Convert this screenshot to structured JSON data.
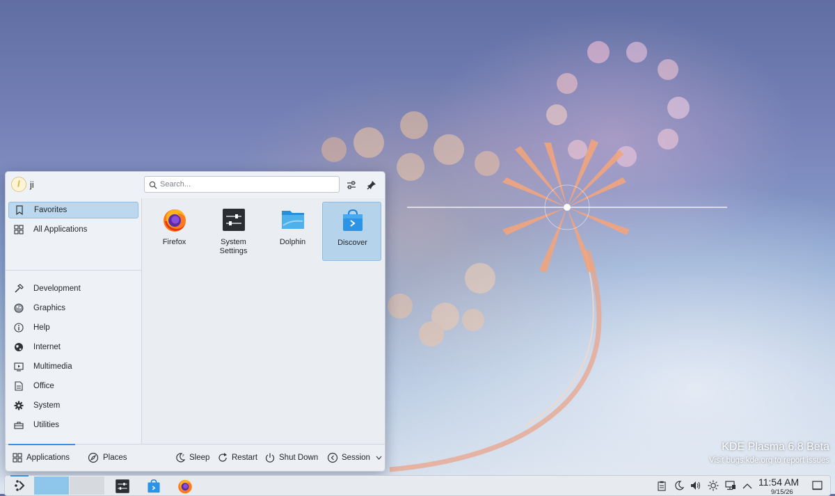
{
  "wallpaper": {
    "title": "KDE Plasma 6.8 Beta",
    "subtitle": "Visit bugs.kde.org to report issues"
  },
  "launcher": {
    "username": "ji",
    "search_placeholder": "Search...",
    "header_buttons": [
      "configure-icon",
      "pin-icon"
    ],
    "sidebar": {
      "items": [
        {
          "label": "Favorites",
          "icon": "bookmark-icon",
          "active": true
        },
        {
          "label": "All Applications",
          "icon": "grid-icon",
          "active": false
        },
        {
          "label": "Development",
          "icon": "hammer-icon",
          "active": false
        },
        {
          "label": "Graphics",
          "icon": "palette-icon",
          "active": false
        },
        {
          "label": "Help",
          "icon": "info-icon",
          "active": false
        },
        {
          "label": "Internet",
          "icon": "globe-icon",
          "active": false
        },
        {
          "label": "Multimedia",
          "icon": "media-icon",
          "active": false
        },
        {
          "label": "Office",
          "icon": "document-icon",
          "active": false
        },
        {
          "label": "System",
          "icon": "gear-icon",
          "active": false
        },
        {
          "label": "Utilities",
          "icon": "toolbox-icon",
          "active": false
        }
      ]
    },
    "favorites": [
      {
        "label": "Firefox",
        "icon": "firefox-icon"
      },
      {
        "label": "System\nSettings",
        "icon": "system-settings-icon"
      },
      {
        "label": "Dolphin",
        "icon": "dolphin-folder-icon"
      },
      {
        "label": "Discover",
        "icon": "discover-icon",
        "selected": true
      }
    ],
    "footer": {
      "tabs": [
        {
          "label": "Applications",
          "icon": "grid-icon",
          "active": true
        },
        {
          "label": "Places",
          "icon": "compass-icon",
          "active": false
        }
      ],
      "actions": [
        {
          "label": "Sleep",
          "icon": "sleep-icon"
        },
        {
          "label": "Restart",
          "icon": "restart-icon"
        },
        {
          "label": "Shut Down",
          "icon": "power-icon"
        },
        {
          "label": "Session",
          "icon": "session-icon"
        }
      ]
    }
  },
  "taskbar": {
    "apps": [
      "system-settings-icon",
      "discover-icon",
      "firefox-icon"
    ],
    "tray": [
      "clipboard-icon",
      "night-mode-icon",
      "volume-icon",
      "brightness-icon",
      "network-icon",
      "expand-tray-icon"
    ],
    "clock": {
      "time": "11:54 AM",
      "date": "9/15/26"
    }
  },
  "colors": {
    "accent": "#3d8ee3",
    "selection": "#bcd8ef",
    "panel": "#eef1f5"
  }
}
